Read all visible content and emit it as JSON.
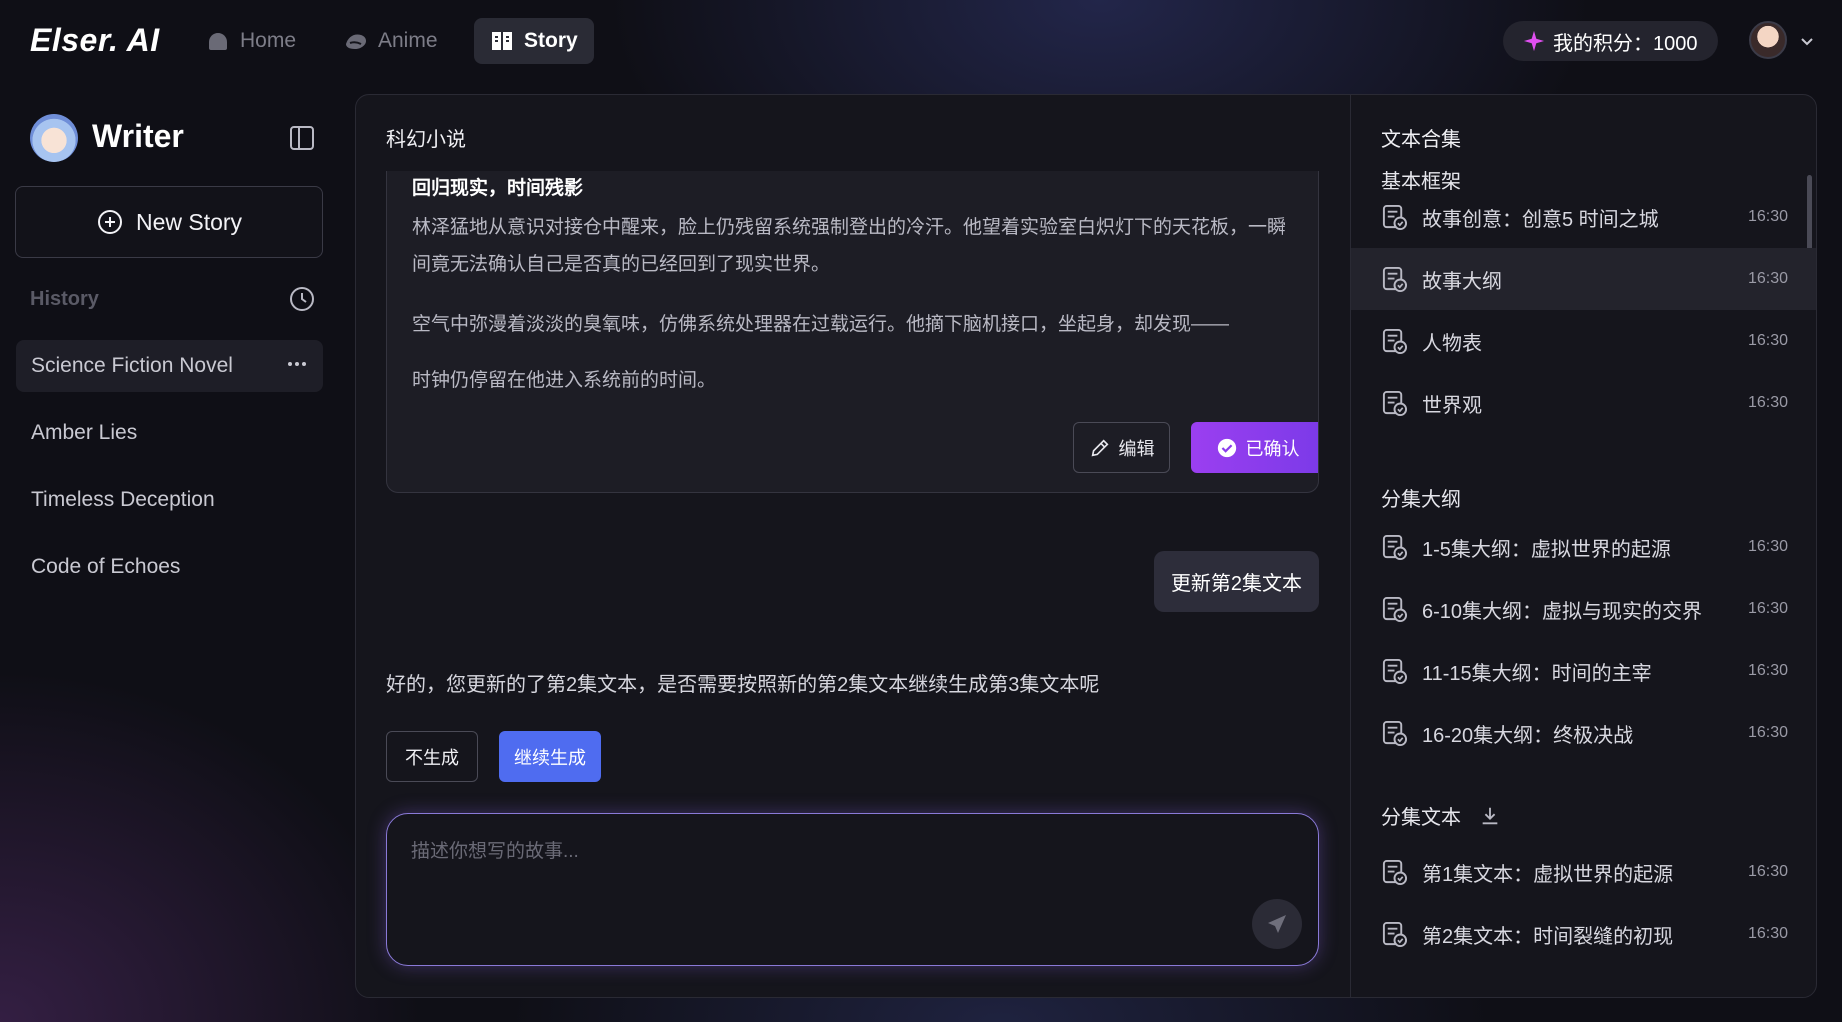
{
  "app": {
    "logo": "Elser. AI"
  },
  "nav": {
    "items": [
      {
        "label": "Home",
        "icon": "home-icon"
      },
      {
        "label": "Anime",
        "icon": "anime-icon"
      },
      {
        "label": "Story",
        "icon": "book-icon",
        "active": true
      }
    ],
    "points": "我的积分：1000"
  },
  "sidebar": {
    "title": "Writer",
    "new_story": "New Story",
    "history_label": "History",
    "items": [
      {
        "label": "Science Fiction Novel",
        "active": true
      },
      {
        "label": "Amber Lies"
      },
      {
        "label": "Timeless Deception"
      },
      {
        "label": "Code of Echoes"
      }
    ]
  },
  "chat": {
    "title": "科幻小说",
    "card": {
      "heading": "回归现实，时间残影",
      "paragraphs": [
        "林泽猛地从意识对接仓中醒来，脸上仍残留系统强制登出的冷汗。他望着实验室白炽灯下的天花板，一瞬间竟无法确认自己是否真的已经回到了现实世界。",
        "空气中弥漫着淡淡的臭氧味，仿佛系统处理器在过载运行。他摘下脑机接口，坐起身，却发现——",
        "时钟仍停留在他进入系统前的时间。"
      ],
      "edit_label": "编辑",
      "confirmed_label": "已确认"
    },
    "user_message": "更新第2集文本",
    "bot_message": "好的，您更新的了第2集文本，是否需要按照新的第2集文本继续生成第3集文本呢",
    "no_label": "不生成",
    "continue_label": "继续生成",
    "input_placeholder": "描述你想写的故事..."
  },
  "collection": {
    "title": "文本合集",
    "sections": [
      {
        "label": "基本框架",
        "items": [
          {
            "title": "故事创意：创意5 时间之城",
            "time": "16:30"
          },
          {
            "title": "故事大纲",
            "time": "16:30",
            "active": true
          },
          {
            "title": "人物表",
            "time": "16:30"
          },
          {
            "title": "世界观",
            "time": "16:30"
          }
        ]
      },
      {
        "label": "分集大纲",
        "items": [
          {
            "title": "1-5集大纲：虚拟世界的起源",
            "time": "16:30"
          },
          {
            "title": "6-10集大纲：虚拟与现实的交界",
            "time": "16:30"
          },
          {
            "title": "11-15集大纲：时间的主宰",
            "time": "16:30"
          },
          {
            "title": "16-20集大纲：终极决战",
            "time": "16:30"
          }
        ]
      },
      {
        "label": "分集文本",
        "items": [
          {
            "title": "第1集文本：虚拟世界的起源",
            "time": "16:30"
          },
          {
            "title": "第2集文本：时间裂缝的初现",
            "time": "16:30"
          }
        ]
      }
    ]
  },
  "colors": {
    "accent_purple": "#9b3ff0",
    "accent_blue": "#4f6cf0",
    "background": "#0f0f16"
  }
}
